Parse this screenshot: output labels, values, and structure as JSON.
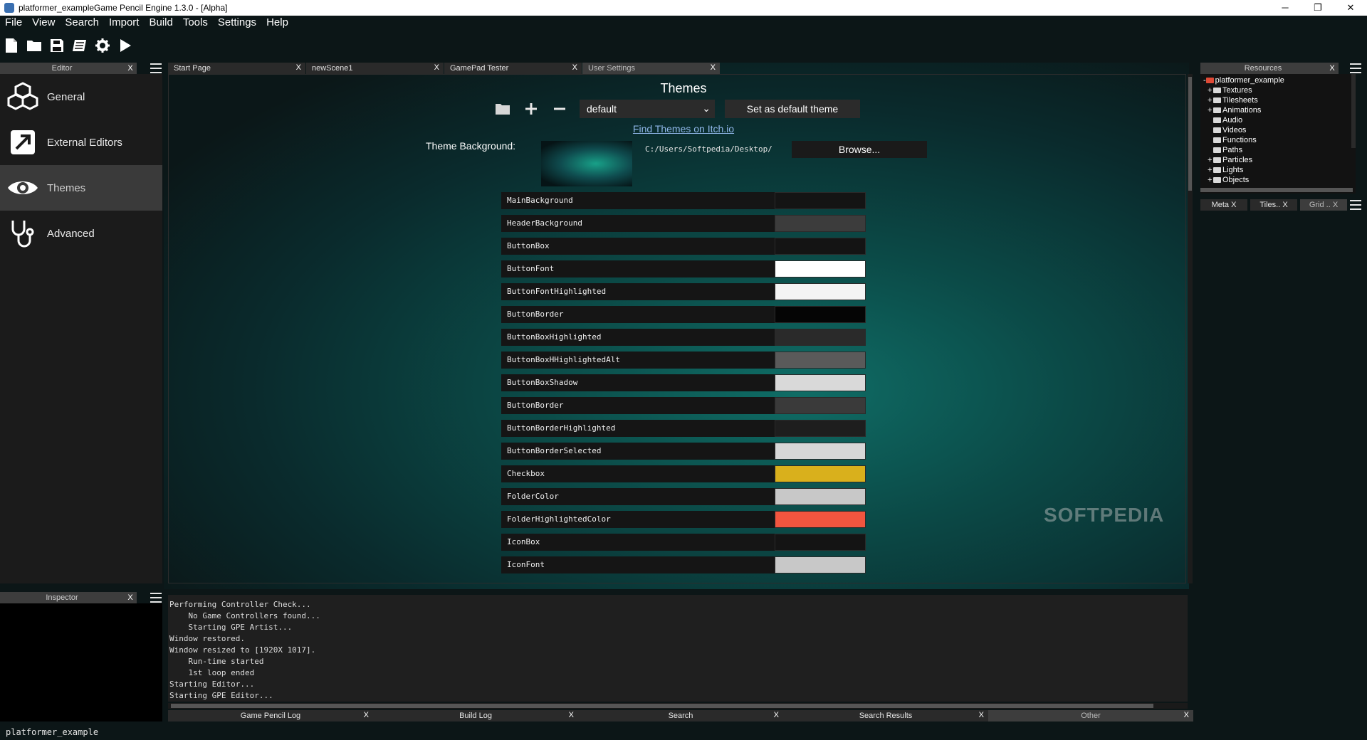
{
  "window": {
    "title": "platformer_exampleGame Pencil Engine  1.3.0 - [Alpha]",
    "minimize": "─",
    "maximize": "❐",
    "close": "✕"
  },
  "menu": [
    "File",
    "View",
    "Search",
    "Import",
    "Build",
    "Tools",
    "Settings",
    "Help"
  ],
  "toolbar": [
    "new-file-icon",
    "open-folder-icon",
    "save-icon",
    "build-icon",
    "settings-gear-icon",
    "play-icon"
  ],
  "editor_panel": {
    "title": "Editor",
    "close": "X",
    "items": [
      {
        "label": "General",
        "icon": "cubes-icon"
      },
      {
        "label": "External Editors",
        "icon": "external-link-icon"
      },
      {
        "label": "Themes",
        "icon": "eye-icon"
      },
      {
        "label": "Advanced",
        "icon": "stethoscope-icon"
      }
    ]
  },
  "inspector_panel": {
    "title": "Inspector",
    "close": "X"
  },
  "tabs": [
    {
      "label": "Start Page",
      "close": "X"
    },
    {
      "label": "newScene1",
      "close": "X"
    },
    {
      "label": "GamePad Tester",
      "close": "X"
    },
    {
      "label": "User Settings",
      "close": "X"
    }
  ],
  "themes": {
    "title": "Themes",
    "selected_theme": "default",
    "chevron": "⌄",
    "set_default_label": "Set as default theme",
    "find_link": "Find Themes on Itch.io",
    "background_label": "Theme Background:",
    "background_path": "C:/Users/Softpedia/Desktop/",
    "browse_label": "Browse..."
  },
  "colors": [
    {
      "name": "MainBackground",
      "color": "#141414"
    },
    {
      "name": "HeaderBackground",
      "color": "#3c3c3c"
    },
    {
      "name": "ButtonBox",
      "color": "#141414"
    },
    {
      "name": "ButtonFont",
      "color": "#ffffff"
    },
    {
      "name": "ButtonFontHighlighted",
      "color": "#f4f4f4"
    },
    {
      "name": "ButtonBorder",
      "color": "#050505"
    },
    {
      "name": "ButtonBoxHighlighted",
      "color": "#2a2a2a"
    },
    {
      "name": "ButtonBoxHHighlightedAlt",
      "color": "#5a5a5a"
    },
    {
      "name": "ButtonBoxShadow",
      "color": "#d9d9d9"
    },
    {
      "name": "ButtonBorder",
      "color": "#3a3a3a"
    },
    {
      "name": "ButtonBorderHighlighted",
      "color": "#1e1e1e"
    },
    {
      "name": "ButtonBorderSelected",
      "color": "#d7d7d7"
    },
    {
      "name": "Checkbox",
      "color": "#d9b01c"
    },
    {
      "name": "FolderColor",
      "color": "#c8c8c8"
    },
    {
      "name": "FolderHighlightedColor",
      "color": "#f2553f"
    },
    {
      "name": "IconBox",
      "color": "#141414"
    },
    {
      "name": "IconFont",
      "color": "#c8c8c8"
    }
  ],
  "watermark": "SOFTPEDIA",
  "log_lines": [
    "Performing Controller Check...",
    "    No Game Controllers found...",
    "    Starting GPE Artist...",
    "Window restored.",
    "Window resized to [1920X 1017].",
    "    Run-time started",
    "    1st loop ended",
    "Starting Editor...",
    "Starting GPE Editor..."
  ],
  "bottom_tabs": [
    {
      "label": "Game Pencil Log",
      "close": "X"
    },
    {
      "label": "Build Log",
      "close": "X"
    },
    {
      "label": "Search",
      "close": "X"
    },
    {
      "label": "Search Results",
      "close": "X"
    },
    {
      "label": "Other",
      "close": "X"
    }
  ],
  "resources": {
    "title": "Resources",
    "close": "X",
    "root": "platformer_example",
    "items": [
      {
        "label": "Textures",
        "expander": "+"
      },
      {
        "label": "Tilesheets",
        "expander": "+"
      },
      {
        "label": "Animations",
        "expander": "+"
      },
      {
        "label": "Audio",
        "expander": ""
      },
      {
        "label": "Videos",
        "expander": ""
      },
      {
        "label": "Functions",
        "expander": ""
      },
      {
        "label": "Paths",
        "expander": ""
      },
      {
        "label": "Particles",
        "expander": "+"
      },
      {
        "label": "Lights",
        "expander": "+"
      },
      {
        "label": "Objects",
        "expander": "+"
      }
    ]
  },
  "mini_tabs": [
    {
      "label": "Meta  X"
    },
    {
      "label": "Tiles.. X"
    },
    {
      "label": "Grid .. X"
    }
  ],
  "status": "platformer_example"
}
